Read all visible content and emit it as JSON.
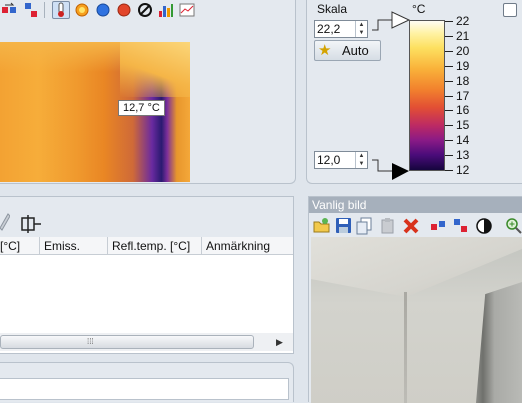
{
  "thermal": {
    "spot_label": "12,7 °C",
    "toolbar_icons": [
      "flip-horizontal-icon",
      "flip-vertical-icon",
      "thermometer-icon",
      "sun-palette-icon",
      "blue-dot-icon",
      "red-dot-icon",
      "no-palette-icon",
      "histogram-icon",
      "graph-icon"
    ]
  },
  "scale": {
    "title": "Skala",
    "unit": "°C",
    "max_value": "22,2",
    "min_value": "12,0",
    "auto_label": "Auto",
    "ticks": [
      "22",
      "21",
      "20",
      "19",
      "18",
      "17",
      "16",
      "15",
      "14",
      "13",
      "12"
    ]
  },
  "table": {
    "columns": [
      "[°C]",
      "Emiss.",
      "Refl.temp. [°C]",
      "Anmärkning"
    ]
  },
  "photo_panel": {
    "title": "Vanlig bild",
    "toolbar_icons": [
      "open-folder-icon",
      "save-icon",
      "copy-icon",
      "paste-icon",
      "delete-icon",
      "flip-horizontal-icon",
      "flip-vertical-icon",
      "contrast-icon",
      "zoom-in-icon"
    ]
  }
}
